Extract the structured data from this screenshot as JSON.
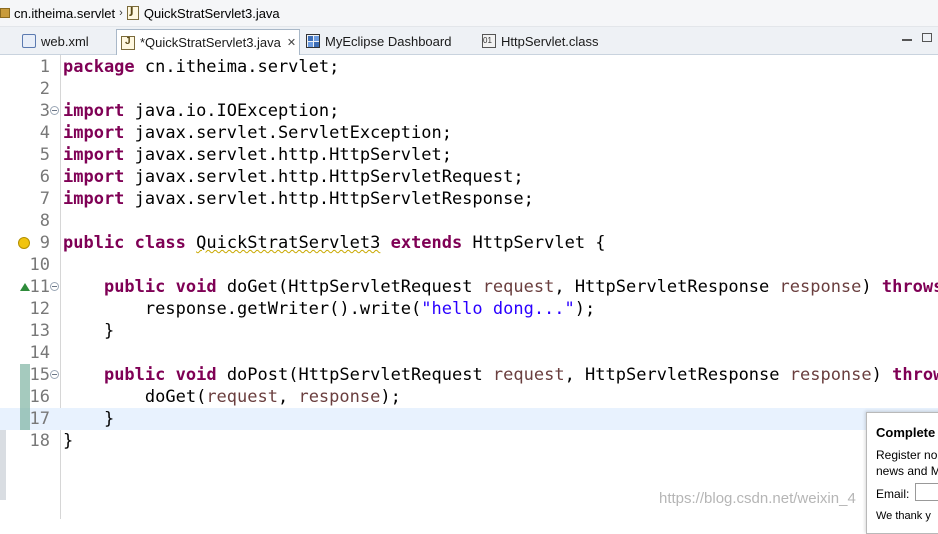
{
  "breadcrumb": {
    "package": "cn.itheima.servlet",
    "separator": "›",
    "file": "QuickStratServlet3.java"
  },
  "tabs": [
    {
      "label": "web.xml",
      "icon": "xml-file-icon",
      "active": false
    },
    {
      "label": "*QuickStratServlet3.java",
      "icon": "java-file-icon",
      "active": true,
      "close": "✕"
    },
    {
      "label": "MyEclipse Dashboard",
      "icon": "dashboard-icon",
      "active": false
    },
    {
      "label": "HttpServlet.class",
      "icon": "class-file-icon",
      "active": false
    }
  ],
  "editor": {
    "line_numbers": [
      "1",
      "2",
      "3",
      "4",
      "5",
      "6",
      "7",
      "8",
      "9",
      "10",
      "11",
      "12",
      "13",
      "14",
      "15",
      "16",
      "17",
      "18"
    ],
    "code": {
      "l1_kw": "package",
      "l1_rest": " cn.itheima.servlet;",
      "import_kw": "import",
      "l3_rest": " java.io.IOException;",
      "l4_rest": " javax.servlet.ServletException;",
      "l5_rest": " javax.servlet.http.HttpServlet;",
      "l6_rest": " javax.servlet.http.HttpServletRequest;",
      "l7_rest": " javax.servlet.http.HttpServletResponse;",
      "l9_public": "public",
      "l9_class": "class",
      "l9_name": "QuickStratServlet3",
      "l9_extends": "extends",
      "l9_rest": " HttpServlet {",
      "l11_public": "public",
      "l11_void": "void",
      "l11_a": " doGet(HttpServletRequest ",
      "l11_p1": "request",
      "l11_b": ", HttpServletResponse ",
      "l11_p2": "response",
      "l11_c": ") ",
      "l11_throws": "throws",
      "l12_a": "response.getWriter().write(",
      "l12_str": "\"hello dong...\"",
      "l12_b": ");",
      "close_brace": "}",
      "l15_public": "public",
      "l15_void": "void",
      "l15_a": " doPost(HttpServletRequest ",
      "l15_p1": "request",
      "l15_b": ", HttpServletResponse ",
      "l15_p2": "response",
      "l15_c": ") ",
      "l15_throws": "throw",
      "l16_a": "doGet(",
      "l16_p1": "request",
      "l16_b": ", ",
      "l16_p2": "response",
      "l16_c": ");"
    }
  },
  "popup": {
    "title": "Complete",
    "text_line1": "Register no",
    "text_line2": "news and M",
    "email_label": "Email:",
    "thanks": "We thank y"
  },
  "watermark": "https://blog.csdn.net/weixin_4",
  "colors": {
    "keyword": "#7f0055",
    "string": "#2a00ff",
    "parameter": "#6a3e3e",
    "line_number": "#787878",
    "current_line": "#e8f2fe"
  }
}
